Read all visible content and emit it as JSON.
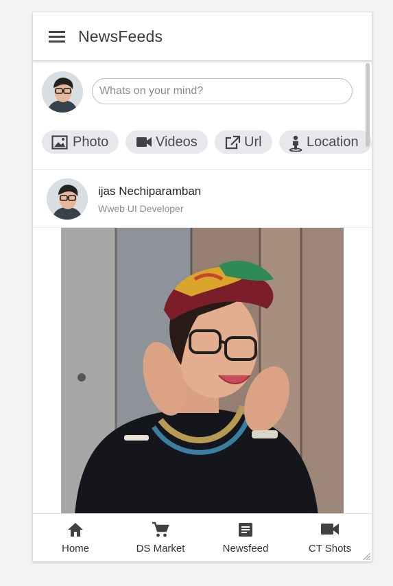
{
  "header": {
    "title": "NewsFeeds",
    "menu_icon": "hamburger-menu-icon"
  },
  "composer": {
    "placeholder": "Whats on your mind?",
    "chips": [
      {
        "label": "Photo",
        "icon": "image-icon"
      },
      {
        "label": "Videos",
        "icon": "videocam-icon"
      },
      {
        "label": "Url",
        "icon": "open-link-icon"
      },
      {
        "label": "Location",
        "icon": "person-pin-icon"
      }
    ]
  },
  "post": {
    "author": "ijas Nechiparamban",
    "role": "Wweb UI Developer"
  },
  "bottom_nav": [
    {
      "label": "Home",
      "icon": "home-icon"
    },
    {
      "label": "DS Market",
      "icon": "cart-icon"
    },
    {
      "label": "Newsfeed",
      "icon": "article-icon"
    },
    {
      "label": "CT Shots",
      "icon": "videocam-icon"
    }
  ],
  "colors": {
    "chip_bg": "#e6e8ec",
    "icon": "#424242",
    "page_bg": "#f3f3f3"
  }
}
